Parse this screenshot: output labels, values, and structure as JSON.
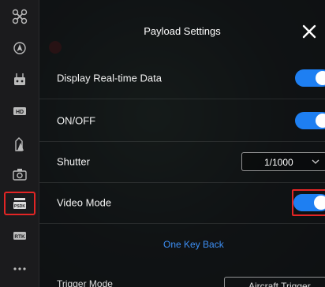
{
  "panel": {
    "title": "Payload Settings"
  },
  "settings": [
    {
      "label": "Display Real-time Data",
      "control": "toggle",
      "on": true
    },
    {
      "label": "ON/OFF",
      "control": "toggle",
      "on": true
    },
    {
      "label": "Shutter",
      "control": "select",
      "value": "1/1000"
    },
    {
      "label": "Video Mode",
      "control": "toggle",
      "on": true,
      "highlighted": true
    }
  ],
  "one_key_back": "One Key Back",
  "partial_row": {
    "label": "Trigger Mode",
    "value": "Aircraft Trigger"
  },
  "sidebar": {
    "items": [
      {
        "icon": "aircraft-icon"
      },
      {
        "icon": "navigation-icon"
      },
      {
        "icon": "remote-controller-icon"
      },
      {
        "icon": "hd-icon",
        "text": "HD"
      },
      {
        "icon": "battery-icon"
      },
      {
        "icon": "camera-icon"
      },
      {
        "icon": "psdk-payload-icon",
        "text": "PSDK",
        "active": true
      },
      {
        "icon": "rtk-icon",
        "text": "RTK"
      },
      {
        "icon": "more-icon"
      }
    ]
  },
  "colors": {
    "accent": "#1e7ff2",
    "highlight": "#e32525",
    "link": "#3d8ff5"
  }
}
